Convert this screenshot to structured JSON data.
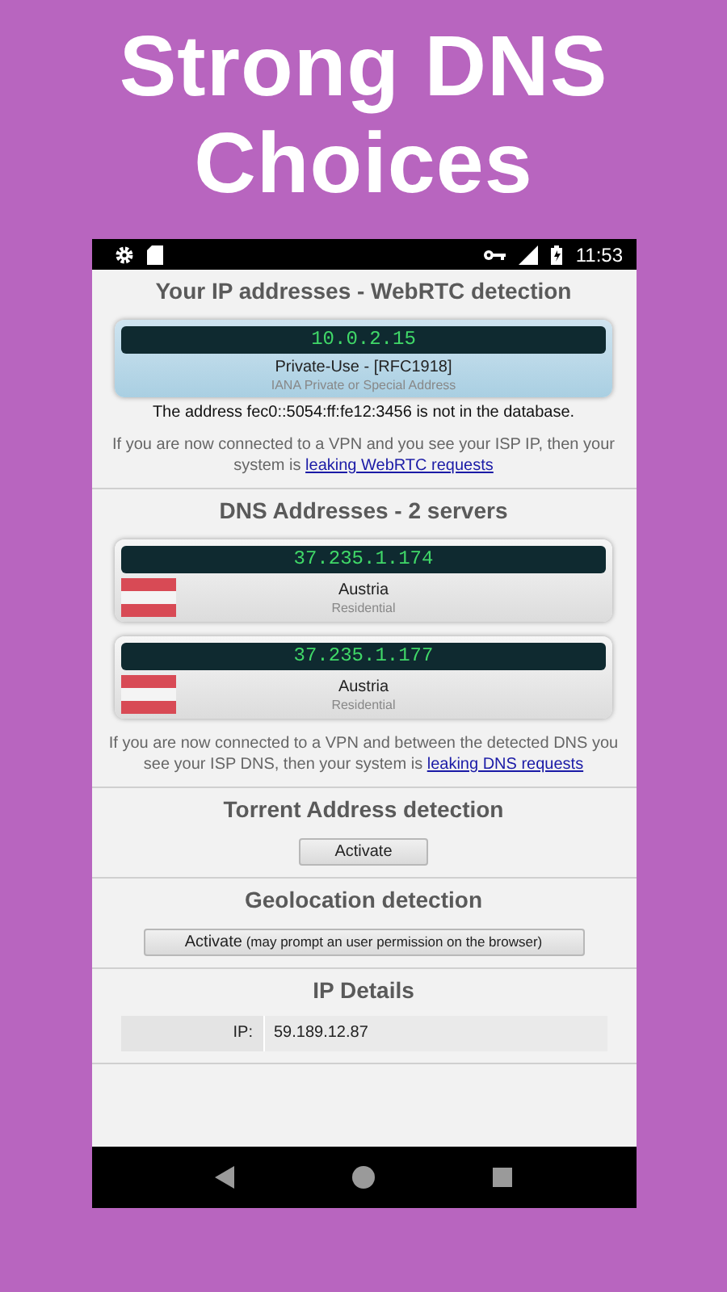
{
  "promo": {
    "headline": "Strong DNS Choices"
  },
  "status_bar": {
    "time": "11:53"
  },
  "webrtc": {
    "title": "Your IP addresses - WebRTC detection",
    "ips": [
      {
        "ip": "10.0.2.15",
        "type": "Private-Use - [RFC1918]",
        "detail": "IANA Private or Special Address"
      }
    ],
    "notice": "The address fec0::5054:ff:fe12:3456 is not in the database.",
    "leak": {
      "text": "If you are now connected to a VPN and you see your ISP IP, then your system is ",
      "link": "leaking WebRTC requests"
    }
  },
  "dns": {
    "title": "DNS Addresses - 2 servers",
    "servers": [
      {
        "ip": "37.235.1.174",
        "country": "Austria",
        "type": "Residential"
      },
      {
        "ip": "37.235.1.177",
        "country": "Austria",
        "type": "Residential"
      }
    ],
    "leak": {
      "text": "If you are now connected to a VPN and between the detected DNS you see your ISP DNS, then your system is ",
      "link": "leaking DNS requests"
    }
  },
  "torrent": {
    "title": "Torrent Address detection",
    "button": {
      "label": "Activate"
    }
  },
  "geolocation": {
    "title": "Geolocation detection",
    "button": {
      "label": "Activate",
      "note": "(may prompt an user permission on the browser)"
    }
  },
  "ip_details": {
    "title": "IP Details",
    "rows": [
      {
        "label": "IP:",
        "value": "59.189.12.87"
      }
    ]
  }
}
